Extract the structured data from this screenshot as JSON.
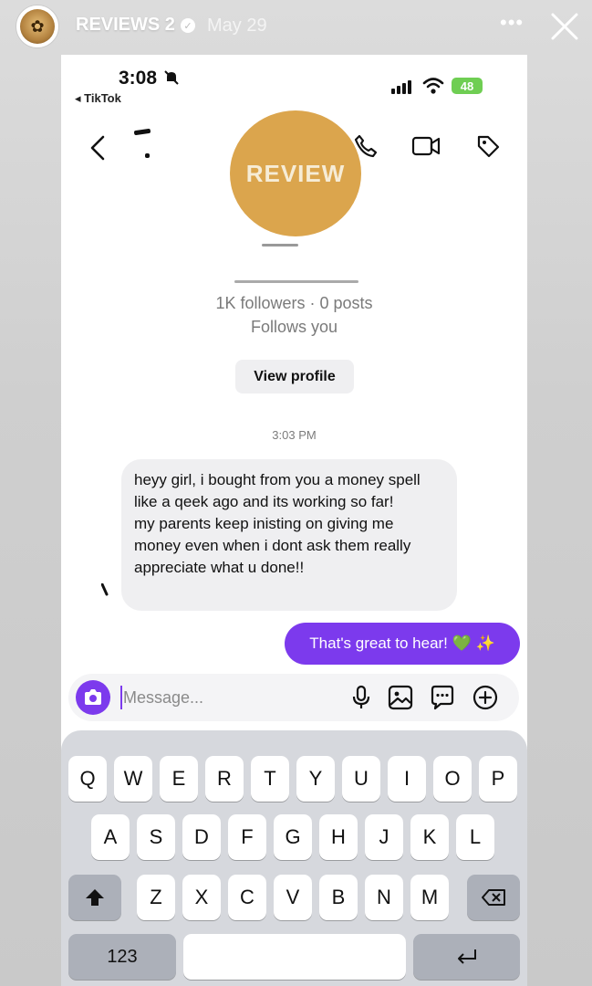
{
  "story": {
    "account_name": "REVIEWS 2",
    "date": "May 29"
  },
  "status_bar": {
    "time": "3:08",
    "back_app": "TikTok",
    "battery": "48"
  },
  "stamp": {
    "text": "REVIEW"
  },
  "profile": {
    "stats": "1K followers · 0 posts",
    "follows": "Follows you",
    "view_profile_label": "View profile"
  },
  "conversation": {
    "timestamp": "3:03 PM",
    "incoming": {
      "line1": "heyy girl, i bought from you a money spell like a qeek ago and its working so far!",
      "line2": "my parents keep inisting on giving me money even when i dont ask them really appreciate what u done!!"
    },
    "outgoing": "That's great to hear! 💚 ✨"
  },
  "composer": {
    "placeholder": "Message..."
  },
  "keyboard": {
    "row1": [
      "Q",
      "W",
      "E",
      "R",
      "T",
      "Y",
      "U",
      "I",
      "O",
      "P"
    ],
    "row2": [
      "A",
      "S",
      "D",
      "F",
      "G",
      "H",
      "J",
      "K",
      "L"
    ],
    "row3": [
      "Z",
      "X",
      "C",
      "V",
      "B",
      "N",
      "M"
    ],
    "numbers_key": "123"
  },
  "colors": {
    "accent": "#7c3aed",
    "stamp": "#dba54d",
    "battery": "#6fce53"
  }
}
